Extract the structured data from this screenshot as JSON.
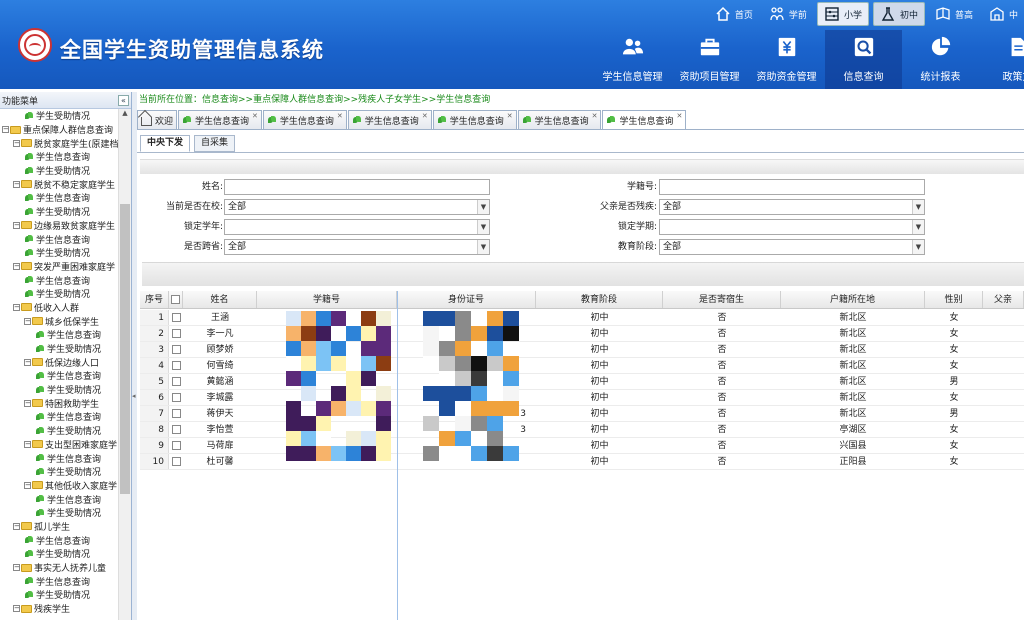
{
  "header": {
    "title": "全国学生资助管理信息系统",
    "top_links": [
      {
        "label": "首页",
        "icon": "home-icon",
        "style": "plain"
      },
      {
        "label": "学前",
        "icon": "children-icon",
        "style": "plain"
      },
      {
        "label": "小学",
        "icon": "abacus-icon",
        "style": "boxed"
      },
      {
        "label": "初中",
        "icon": "flask-icon",
        "style": "active"
      },
      {
        "label": "普高",
        "icon": "book-icon",
        "style": "plain"
      },
      {
        "label": "中",
        "icon": "building-icon",
        "style": "plain"
      }
    ],
    "nav": [
      {
        "label": "学生信息管理",
        "icon": "users-icon"
      },
      {
        "label": "资助项目管理",
        "icon": "briefcase-icon"
      },
      {
        "label": "资助资金管理",
        "icon": "yuan-icon"
      },
      {
        "label": "信息查询",
        "icon": "magnifier-icon",
        "active": true
      },
      {
        "label": "统计报表",
        "icon": "pie-chart-icon"
      },
      {
        "label": "政策文",
        "icon": "document-icon"
      }
    ],
    "colors": {
      "header_blue": "#1a63cc",
      "nav_active": "#153c8c"
    }
  },
  "sidebar": {
    "title": "功能菜单",
    "collapse_label": "«",
    "tree": [
      {
        "label": "学生受助情况",
        "level": 2,
        "type": "leaf"
      },
      {
        "label": "重点保障人群信息查询",
        "level": 0,
        "type": "folder"
      },
      {
        "label": "脱贫家庭学生(原建档",
        "level": 1,
        "type": "folder"
      },
      {
        "label": "学生信息查询",
        "level": 2,
        "type": "leaf"
      },
      {
        "label": "学生受助情况",
        "level": 2,
        "type": "leaf"
      },
      {
        "label": "脱贫不稳定家庭学生",
        "level": 1,
        "type": "folder"
      },
      {
        "label": "学生信息查询",
        "level": 2,
        "type": "leaf"
      },
      {
        "label": "学生受助情况",
        "level": 2,
        "type": "leaf"
      },
      {
        "label": "边缘易致贫家庭学生",
        "level": 1,
        "type": "folder"
      },
      {
        "label": "学生信息查询",
        "level": 2,
        "type": "leaf"
      },
      {
        "label": "学生受助情况",
        "level": 2,
        "type": "leaf"
      },
      {
        "label": "突发严重困难家庭学",
        "level": 1,
        "type": "folder"
      },
      {
        "label": "学生信息查询",
        "level": 2,
        "type": "leaf"
      },
      {
        "label": "学生受助情况",
        "level": 2,
        "type": "leaf"
      },
      {
        "label": "低收入人群",
        "level": 1,
        "type": "folder"
      },
      {
        "label": "城乡低保学生",
        "level": 2,
        "type": "folder"
      },
      {
        "label": "学生信息查询",
        "level": 3,
        "type": "leaf"
      },
      {
        "label": "学生受助情况",
        "level": 3,
        "type": "leaf"
      },
      {
        "label": "低保边缘人口",
        "level": 2,
        "type": "folder"
      },
      {
        "label": "学生信息查询",
        "level": 3,
        "type": "leaf"
      },
      {
        "label": "学生受助情况",
        "level": 3,
        "type": "leaf"
      },
      {
        "label": "特困救助学生",
        "level": 2,
        "type": "folder"
      },
      {
        "label": "学生信息查询",
        "level": 3,
        "type": "leaf"
      },
      {
        "label": "学生受助情况",
        "level": 3,
        "type": "leaf"
      },
      {
        "label": "支出型困难家庭学",
        "level": 2,
        "type": "folder"
      },
      {
        "label": "学生信息查询",
        "level": 3,
        "type": "leaf"
      },
      {
        "label": "学生受助情况",
        "level": 3,
        "type": "leaf"
      },
      {
        "label": "其他低收入家庭学",
        "level": 2,
        "type": "folder"
      },
      {
        "label": "学生信息查询",
        "level": 3,
        "type": "leaf"
      },
      {
        "label": "学生受助情况",
        "level": 3,
        "type": "leaf"
      },
      {
        "label": "孤儿学生",
        "level": 1,
        "type": "folder"
      },
      {
        "label": "学生信息查询",
        "level": 2,
        "type": "leaf"
      },
      {
        "label": "学生受助情况",
        "level": 2,
        "type": "leaf"
      },
      {
        "label": "事实无人抚养儿童",
        "level": 1,
        "type": "folder"
      },
      {
        "label": "学生信息查询",
        "level": 2,
        "type": "leaf"
      },
      {
        "label": "学生受助情况",
        "level": 2,
        "type": "leaf"
      },
      {
        "label": "残疾学生",
        "level": 1,
        "type": "folder"
      }
    ]
  },
  "location": "当前所在位置：信息查询>>重点保障人群信息查询>>残疾人子女学生>>学生信息查询",
  "tabs": [
    {
      "label": "欢迎",
      "icon": "home-icon",
      "closable": false
    },
    {
      "label": "学生信息查询",
      "icon": "leaf-icon",
      "closable": true
    },
    {
      "label": "学生信息查询",
      "icon": "leaf-icon",
      "closable": true
    },
    {
      "label": "学生信息查询",
      "icon": "leaf-icon",
      "closable": true
    },
    {
      "label": "学生信息查询",
      "icon": "leaf-icon",
      "closable": true
    },
    {
      "label": "学生信息查询",
      "icon": "leaf-icon",
      "closable": true
    },
    {
      "label": "学生信息查询",
      "icon": "leaf-icon",
      "closable": true,
      "active": true
    }
  ],
  "subtabs": [
    {
      "label": "中央下发",
      "active": true
    },
    {
      "label": "自采集",
      "active": false
    }
  ],
  "form": {
    "rows": [
      {
        "left": {
          "label": "姓名:",
          "type": "text",
          "value": ""
        },
        "right": {
          "label": "学籍号:",
          "type": "text",
          "value": ""
        }
      },
      {
        "left": {
          "label": "当前是否在校:",
          "type": "select",
          "value": "全部"
        },
        "right": {
          "label": "父亲是否残疾:",
          "type": "select",
          "value": "全部"
        }
      },
      {
        "left": {
          "label": "锁定学年:",
          "type": "select",
          "value": ""
        },
        "right": {
          "label": "锁定学期:",
          "type": "select",
          "value": ""
        }
      },
      {
        "left": {
          "label": "是否跨省:",
          "type": "select",
          "value": "全部"
        },
        "right": {
          "label": "教育阶段:",
          "type": "select",
          "value": "全部"
        }
      }
    ]
  },
  "grid": {
    "columns": [
      "序号",
      "",
      "姓名",
      "学籍号",
      "身份证号",
      "教育阶段",
      "是否寄宿生",
      "户籍所在地",
      "性别",
      "父亲"
    ],
    "rows": [
      {
        "no": "1",
        "name": "王涵",
        "stage": "初中",
        "boarding": "否",
        "region": "新北区",
        "gender": "女",
        "id_tail": ""
      },
      {
        "no": "2",
        "name": "李一凡",
        "stage": "初中",
        "boarding": "否",
        "region": "新北区",
        "gender": "女",
        "id_tail": ""
      },
      {
        "no": "3",
        "name": "顾梦娇",
        "stage": "初中",
        "boarding": "否",
        "region": "新北区",
        "gender": "女",
        "id_tail": ""
      },
      {
        "no": "4",
        "name": "何雪绮",
        "stage": "初中",
        "boarding": "否",
        "region": "新北区",
        "gender": "女",
        "id_tail": ""
      },
      {
        "no": "5",
        "name": "黄懿涵",
        "stage": "初中",
        "boarding": "否",
        "region": "新北区",
        "gender": "男",
        "id_tail": ""
      },
      {
        "no": "6",
        "name": "李城露",
        "stage": "初中",
        "boarding": "否",
        "region": "新北区",
        "gender": "女",
        "id_tail": ""
      },
      {
        "no": "7",
        "name": "蒋伊天",
        "stage": "初中",
        "boarding": "否",
        "region": "新北区",
        "gender": "男",
        "id_tail": "3"
      },
      {
        "no": "8",
        "name": "李怡萱",
        "stage": "初中",
        "boarding": "否",
        "region": "亭湖区",
        "gender": "女",
        "id_tail": "3"
      },
      {
        "no": "9",
        "name": "马荷扉",
        "stage": "初中",
        "boarding": "否",
        "region": "兴国县",
        "gender": "女",
        "id_tail": ""
      },
      {
        "no": "10",
        "name": "杜可馨",
        "stage": "初中",
        "boarding": "否",
        "region": "正阳县",
        "gender": "女",
        "id_tail": ""
      }
    ],
    "colors": {
      "row_number_bg": "#f3f3f3",
      "divider": "#9fc0e8"
    }
  }
}
